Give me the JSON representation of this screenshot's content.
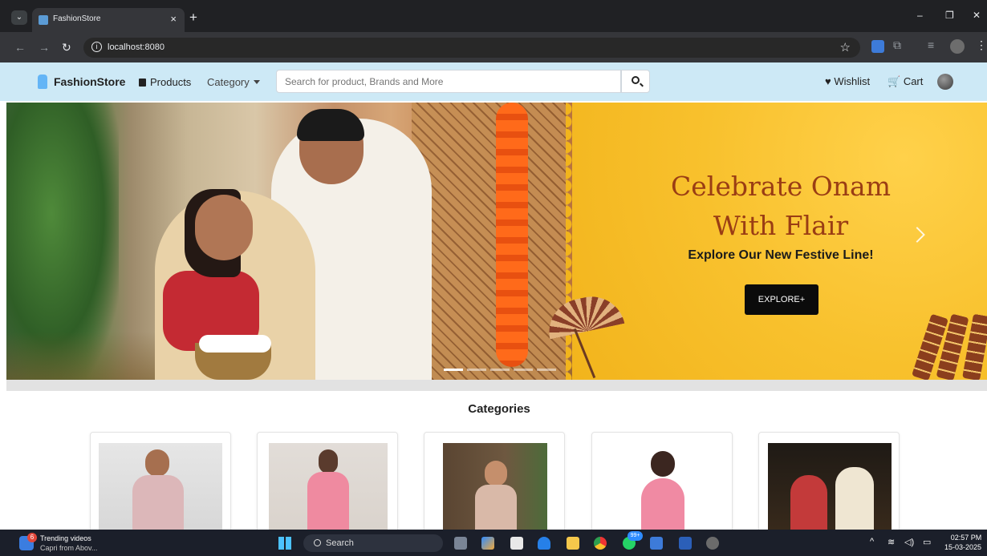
{
  "browser": {
    "tab_title": "FashionStore",
    "tab_close": "×",
    "new_tab": "+",
    "url": "localhost:8080",
    "window_controls": {
      "minimize": "–",
      "restore": "❐",
      "close": "✕"
    }
  },
  "navbar": {
    "brand": "FashionStore",
    "products_label": "Products",
    "category_label": "Category",
    "search_placeholder": "Search for product, Brands and More",
    "wishlist_label": "Wishlist",
    "cart_label": "Cart"
  },
  "hero": {
    "title_line1": "Celebrate Onam",
    "title_line2": "With Flair",
    "subtitle": "Explore Our New Festive Line!",
    "cta_label": "EXPLORE+",
    "slide_count": 5,
    "active_slide": 1
  },
  "categories": {
    "heading": "Categories",
    "cards": [
      {
        "image": "men-category-photo"
      },
      {
        "image": "women-category-photo"
      },
      {
        "image": "boys-category-photo"
      },
      {
        "image": "girls-category-photo"
      },
      {
        "image": "couple-category-photo"
      }
    ]
  },
  "taskbar": {
    "weather_badge": "6",
    "widget_title": "Trending videos",
    "widget_subtitle": "Capri from Abov...",
    "search_label": "Search",
    "whatsapp_badge": "99+",
    "time": "02:57 PM",
    "date": "15-03-2025"
  },
  "colors": {
    "navbar_bg": "#cde9f6",
    "hero_title": "#9a3d14",
    "hero_yellow": "#f8c12d",
    "cta_bg": "#0b0b0b",
    "browser_chrome": "#202124"
  }
}
